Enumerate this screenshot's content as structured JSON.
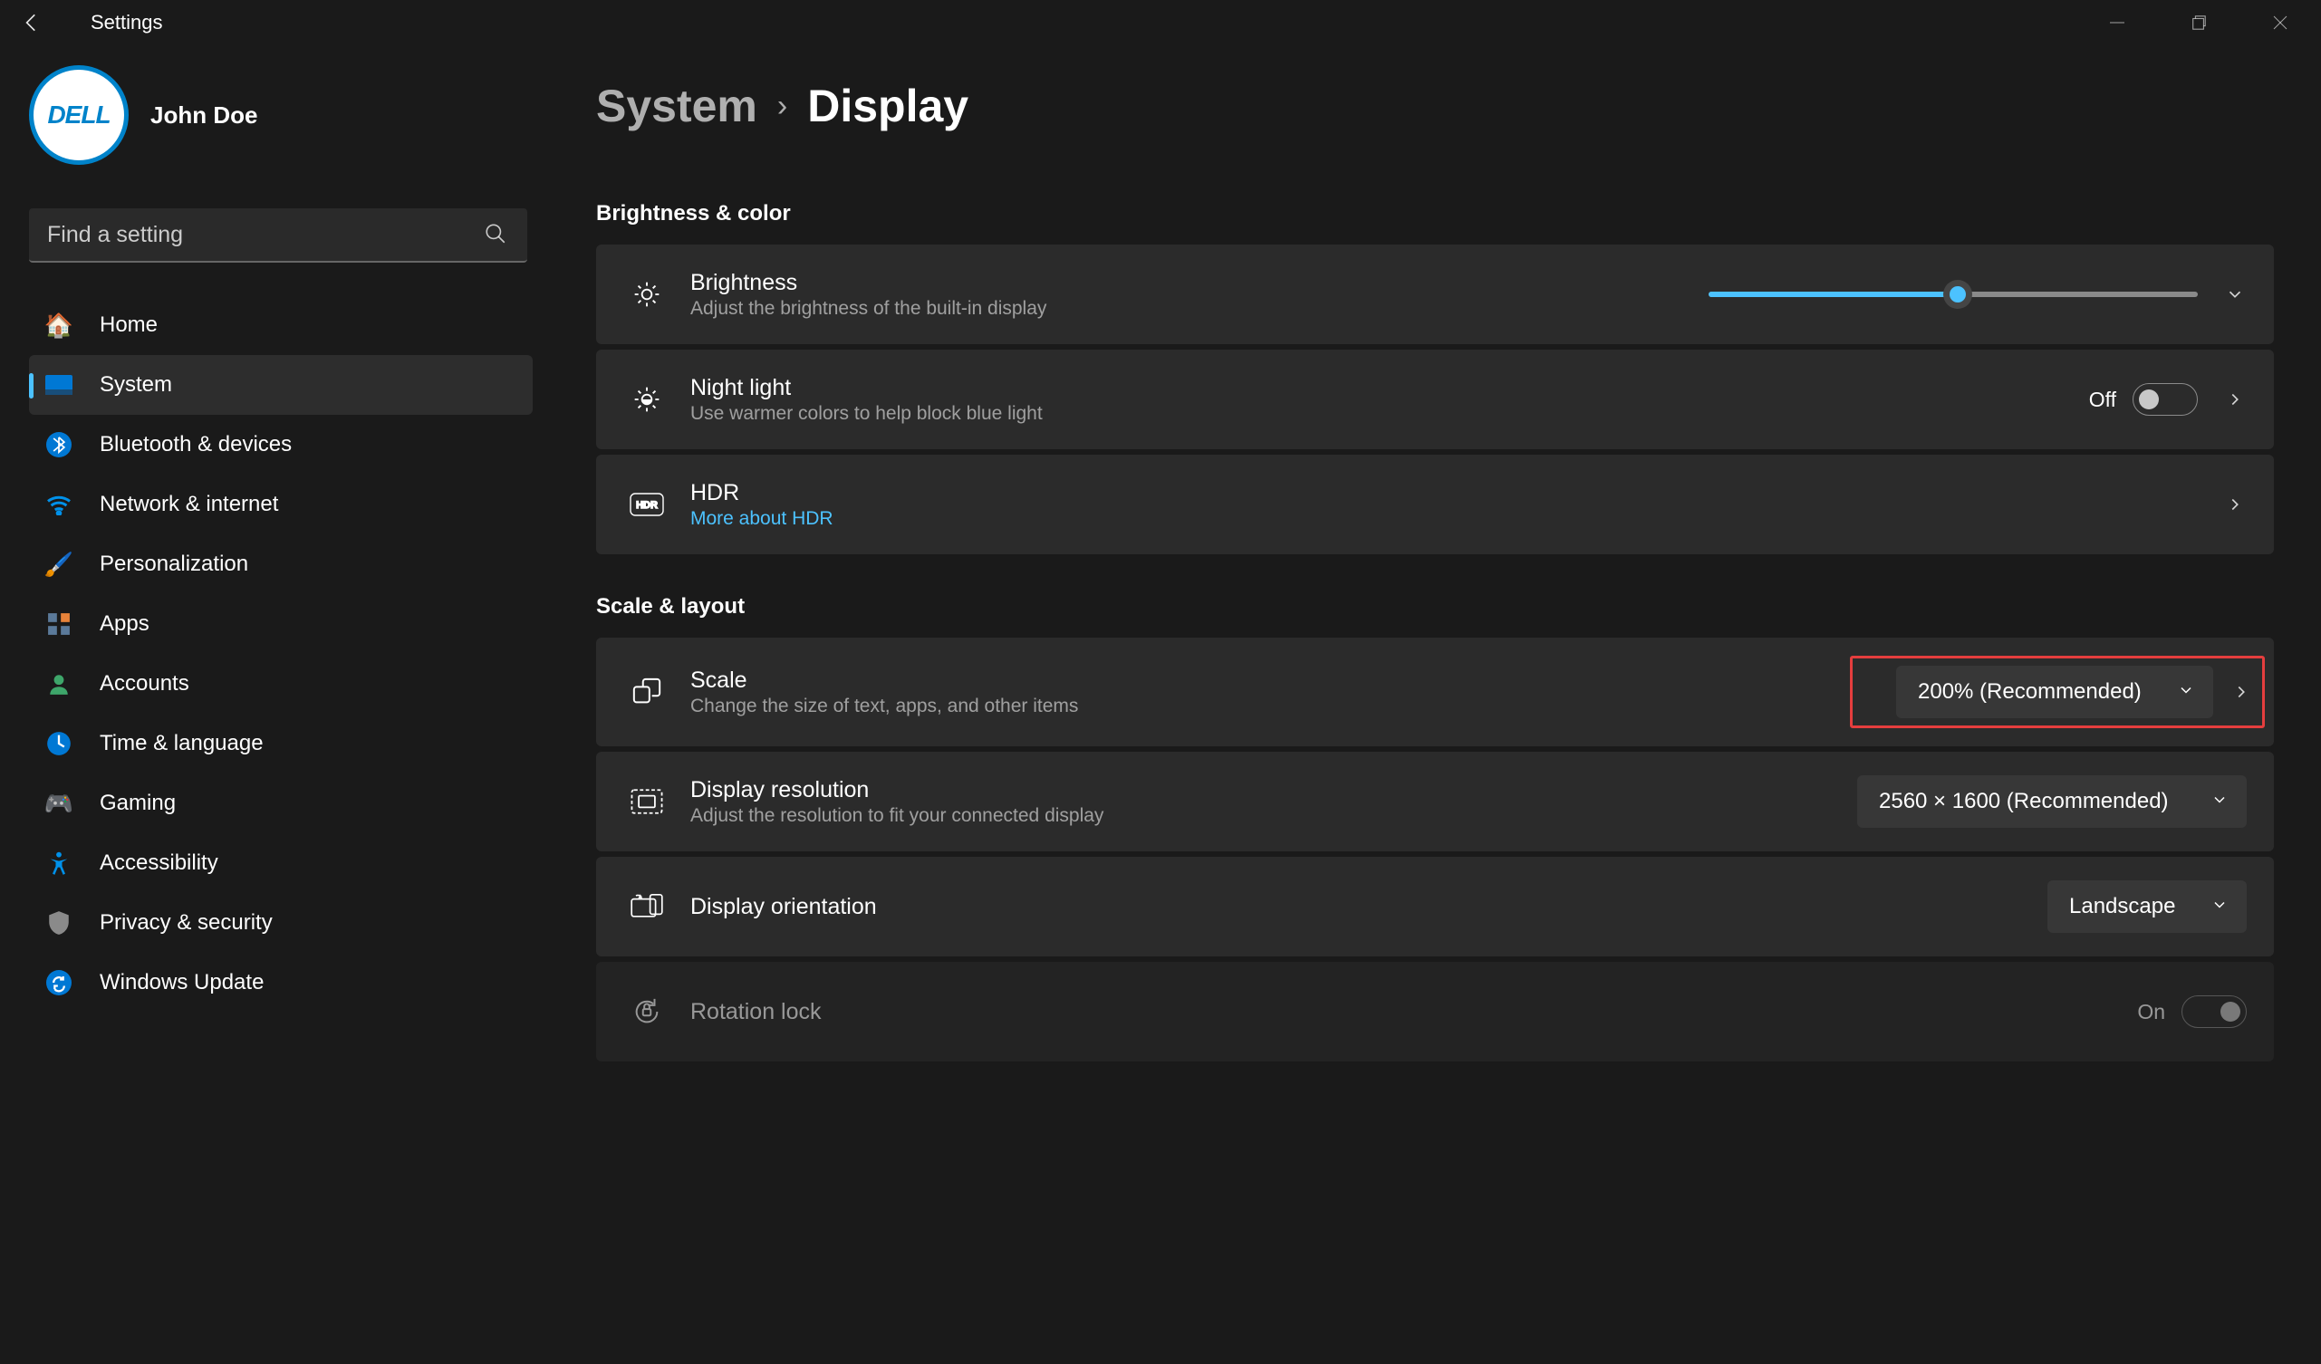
{
  "titlebar": {
    "title": "Settings"
  },
  "profile": {
    "name": "John Doe",
    "avatar_text": "DELL"
  },
  "search": {
    "placeholder": "Find a setting"
  },
  "nav": {
    "items": [
      {
        "label": "Home"
      },
      {
        "label": "System"
      },
      {
        "label": "Bluetooth & devices"
      },
      {
        "label": "Network & internet"
      },
      {
        "label": "Personalization"
      },
      {
        "label": "Apps"
      },
      {
        "label": "Accounts"
      },
      {
        "label": "Time & language"
      },
      {
        "label": "Gaming"
      },
      {
        "label": "Accessibility"
      },
      {
        "label": "Privacy & security"
      },
      {
        "label": "Windows Update"
      }
    ]
  },
  "breadcrumb": {
    "parent": "System",
    "current": "Display"
  },
  "sections": {
    "brightness_color": {
      "title": "Brightness & color"
    },
    "scale_layout": {
      "title": "Scale & layout"
    }
  },
  "settings": {
    "brightness": {
      "title": "Brightness",
      "desc": "Adjust the brightness of the built-in display",
      "value_pct": 51
    },
    "night_light": {
      "title": "Night light",
      "desc": "Use warmer colors to help block blue light",
      "state_label": "Off"
    },
    "hdr": {
      "title": "HDR",
      "link": "More about HDR"
    },
    "scale": {
      "title": "Scale",
      "desc": "Change the size of text, apps, and other items",
      "value": "200% (Recommended)"
    },
    "resolution": {
      "title": "Display resolution",
      "desc": "Adjust the resolution to fit your connected display",
      "value": "2560 × 1600 (Recommended)"
    },
    "orientation": {
      "title": "Display orientation",
      "value": "Landscape"
    },
    "rotation_lock": {
      "title": "Rotation lock",
      "state_label": "On"
    }
  }
}
